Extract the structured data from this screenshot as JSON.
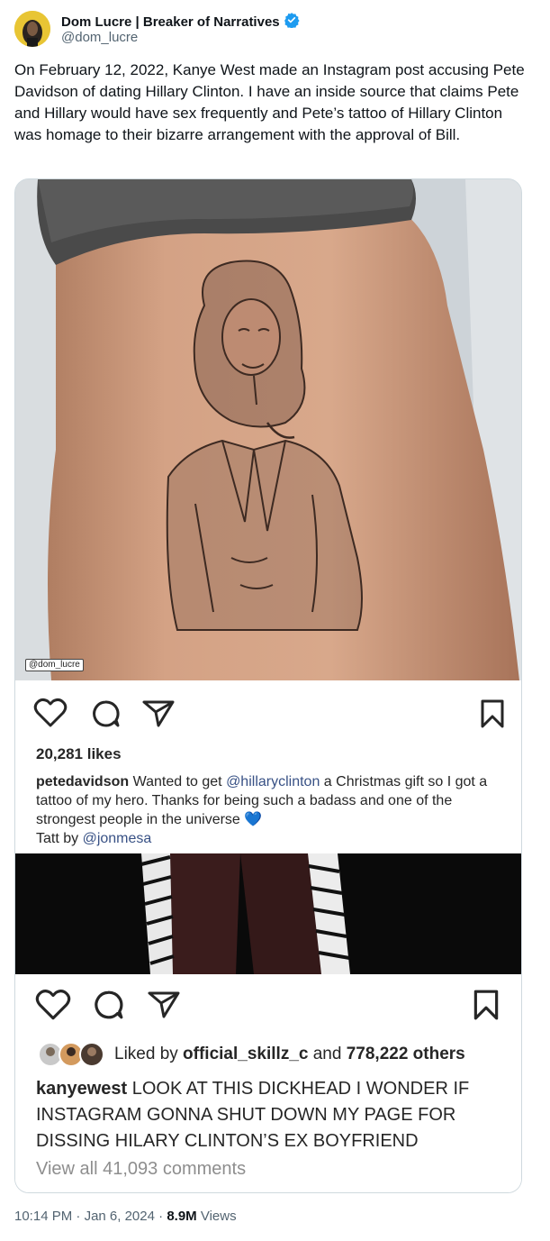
{
  "author": {
    "name": "Dom Lucre | Breaker of Narratives",
    "handle": "@dom_lucre",
    "verified_icon": "verified-badge-icon"
  },
  "tweet": {
    "text": "On February 12, 2022, Kanye West made an Instagram post accusing Pete Davidson of dating Hillary Clinton. I have an inside source that claims Pete and Hillary would have sex frequently and Pete’s tattoo of Hillary Clinton was homage to their bizarre arrangement with the approval of Bill."
  },
  "media": {
    "watermark": "@dom_lucre",
    "post1": {
      "likes": "20,281 likes",
      "username": "petedavidson",
      "caption_a": " Wanted to get ",
      "mention1": "@hillaryclinton",
      "caption_b": " a Christmas gift so I got a tattoo of my hero. Thanks for being such a badass and one of the strongest people in the universe 💙",
      "tatt_by": "Tatt by ",
      "mention2": "@jonmesa"
    },
    "post2": {
      "liked_by_prefix": "Liked by ",
      "liked_by_user": "official_skillz_c",
      "liked_by_and": " and ",
      "liked_by_count": "778,222 others",
      "username": "kanyewest",
      "caption": " LOOK AT THIS DICKHEAD  I WONDER IF INSTAGRAM GONNA SHUT DOWN MY PAGE FOR DISSING HILARY CLINTON’S EX BOYFRIEND",
      "view_all": "View all 41,093 comments"
    }
  },
  "footer": {
    "time": "10:14 PM",
    "sep1": " · ",
    "date": "Jan 6, 2024",
    "sep2": " · ",
    "views_count": "8.9M",
    "views_label": " Views"
  },
  "colors": {
    "text": "#0f1419",
    "secondary": "#536471",
    "verified": "#1d9bf0",
    "ig_link": "#385185"
  }
}
